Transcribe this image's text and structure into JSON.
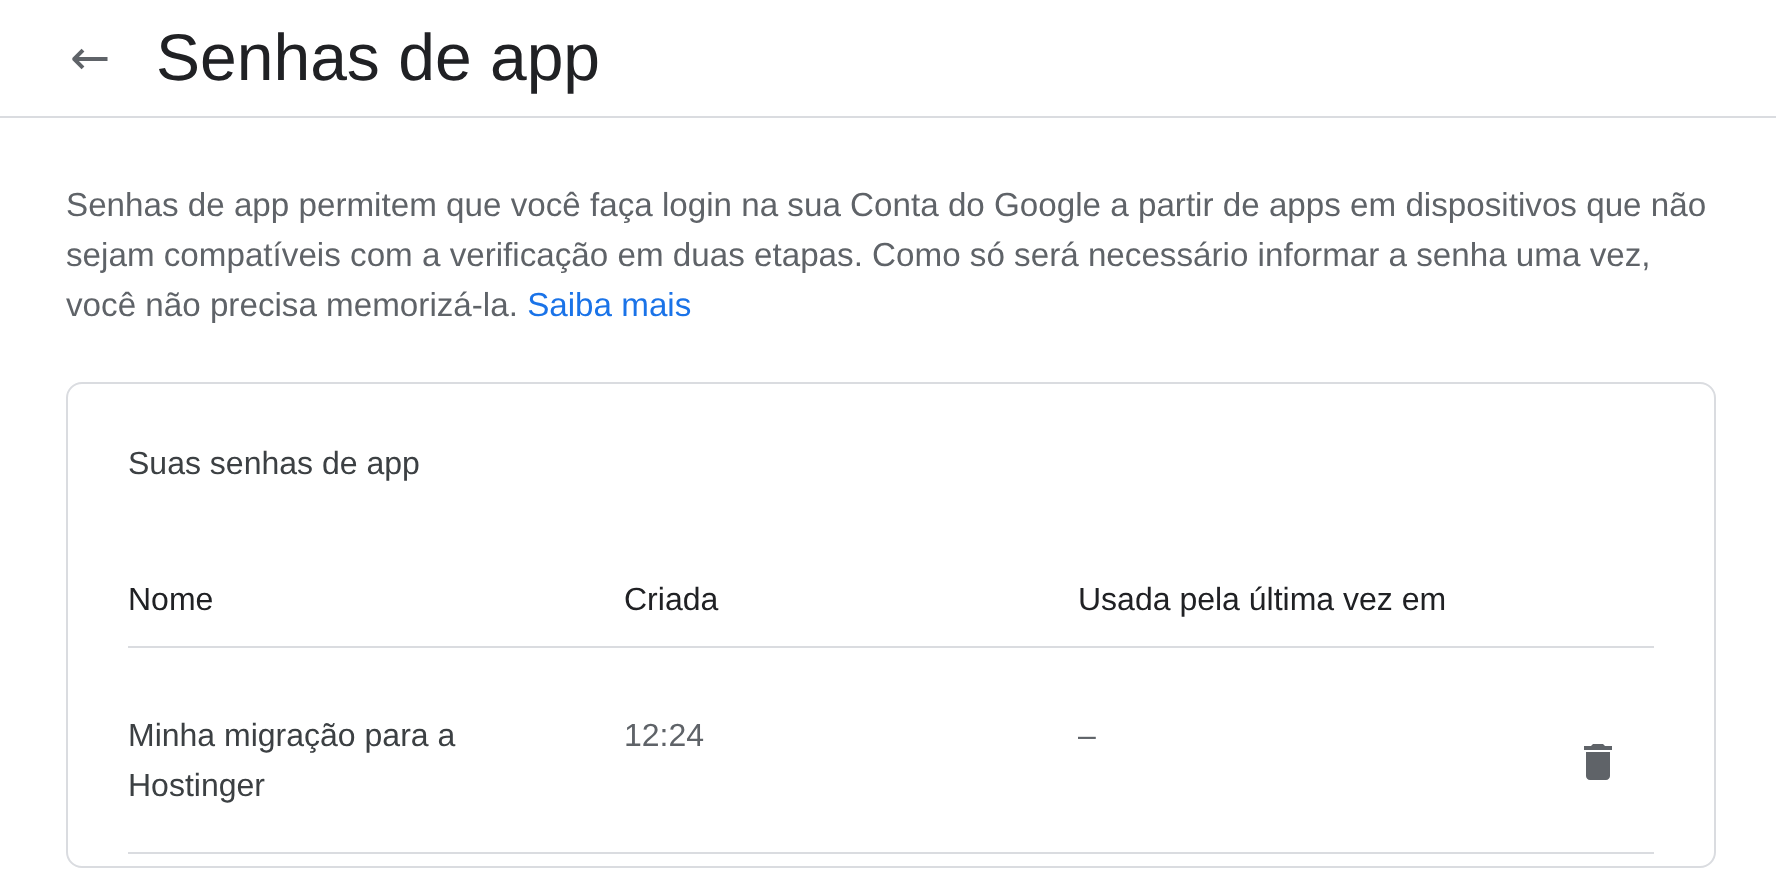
{
  "header": {
    "back": "←",
    "title": "Senhas de app"
  },
  "description": {
    "text": "Senhas de app permitem que você faça login na sua Conta do Google a partir de apps em dispositivos que não sejam compatíveis com a verificação em duas etapas. Como só será necessário informar a senha uma vez, você não precisa memorizá-la.",
    "link": "Saiba mais"
  },
  "card": {
    "title": "Suas senhas de app",
    "columns": [
      "Nome",
      "Criada",
      "Usada pela última vez em"
    ],
    "rows": [
      {
        "name": "Minha migração para a Hostinger",
        "created": "12:24",
        "last_used": "–"
      }
    ]
  }
}
